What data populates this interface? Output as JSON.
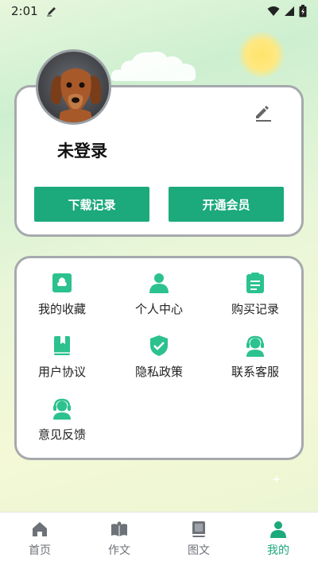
{
  "status_bar": {
    "time": "2:01"
  },
  "profile": {
    "username": "未登录",
    "buttons": {
      "download_records": "下载记录",
      "open_vip": "开通会员"
    }
  },
  "menu": {
    "items": [
      {
        "label": "我的收藏",
        "icon": "favorites-icon"
      },
      {
        "label": "个人中心",
        "icon": "person-icon"
      },
      {
        "label": "购买记录",
        "icon": "clipboard-icon"
      },
      {
        "label": "用户协议",
        "icon": "bookmark-book-icon"
      },
      {
        "label": "隐私政策",
        "icon": "shield-check-icon"
      },
      {
        "label": "联系客服",
        "icon": "headset-icon"
      },
      {
        "label": "意见反馈",
        "icon": "headset-feedback-icon"
      }
    ]
  },
  "bottom_nav": {
    "tabs": [
      {
        "label": "首页",
        "icon": "home-icon"
      },
      {
        "label": "作文",
        "icon": "open-book-icon"
      },
      {
        "label": "图文",
        "icon": "book-icon"
      },
      {
        "label": "我的",
        "icon": "user-icon"
      }
    ],
    "active_index": 3
  },
  "colors": {
    "accent": "#1ca97c",
    "inactive": "#6d7278",
    "card_border": "#a6a9ad"
  }
}
